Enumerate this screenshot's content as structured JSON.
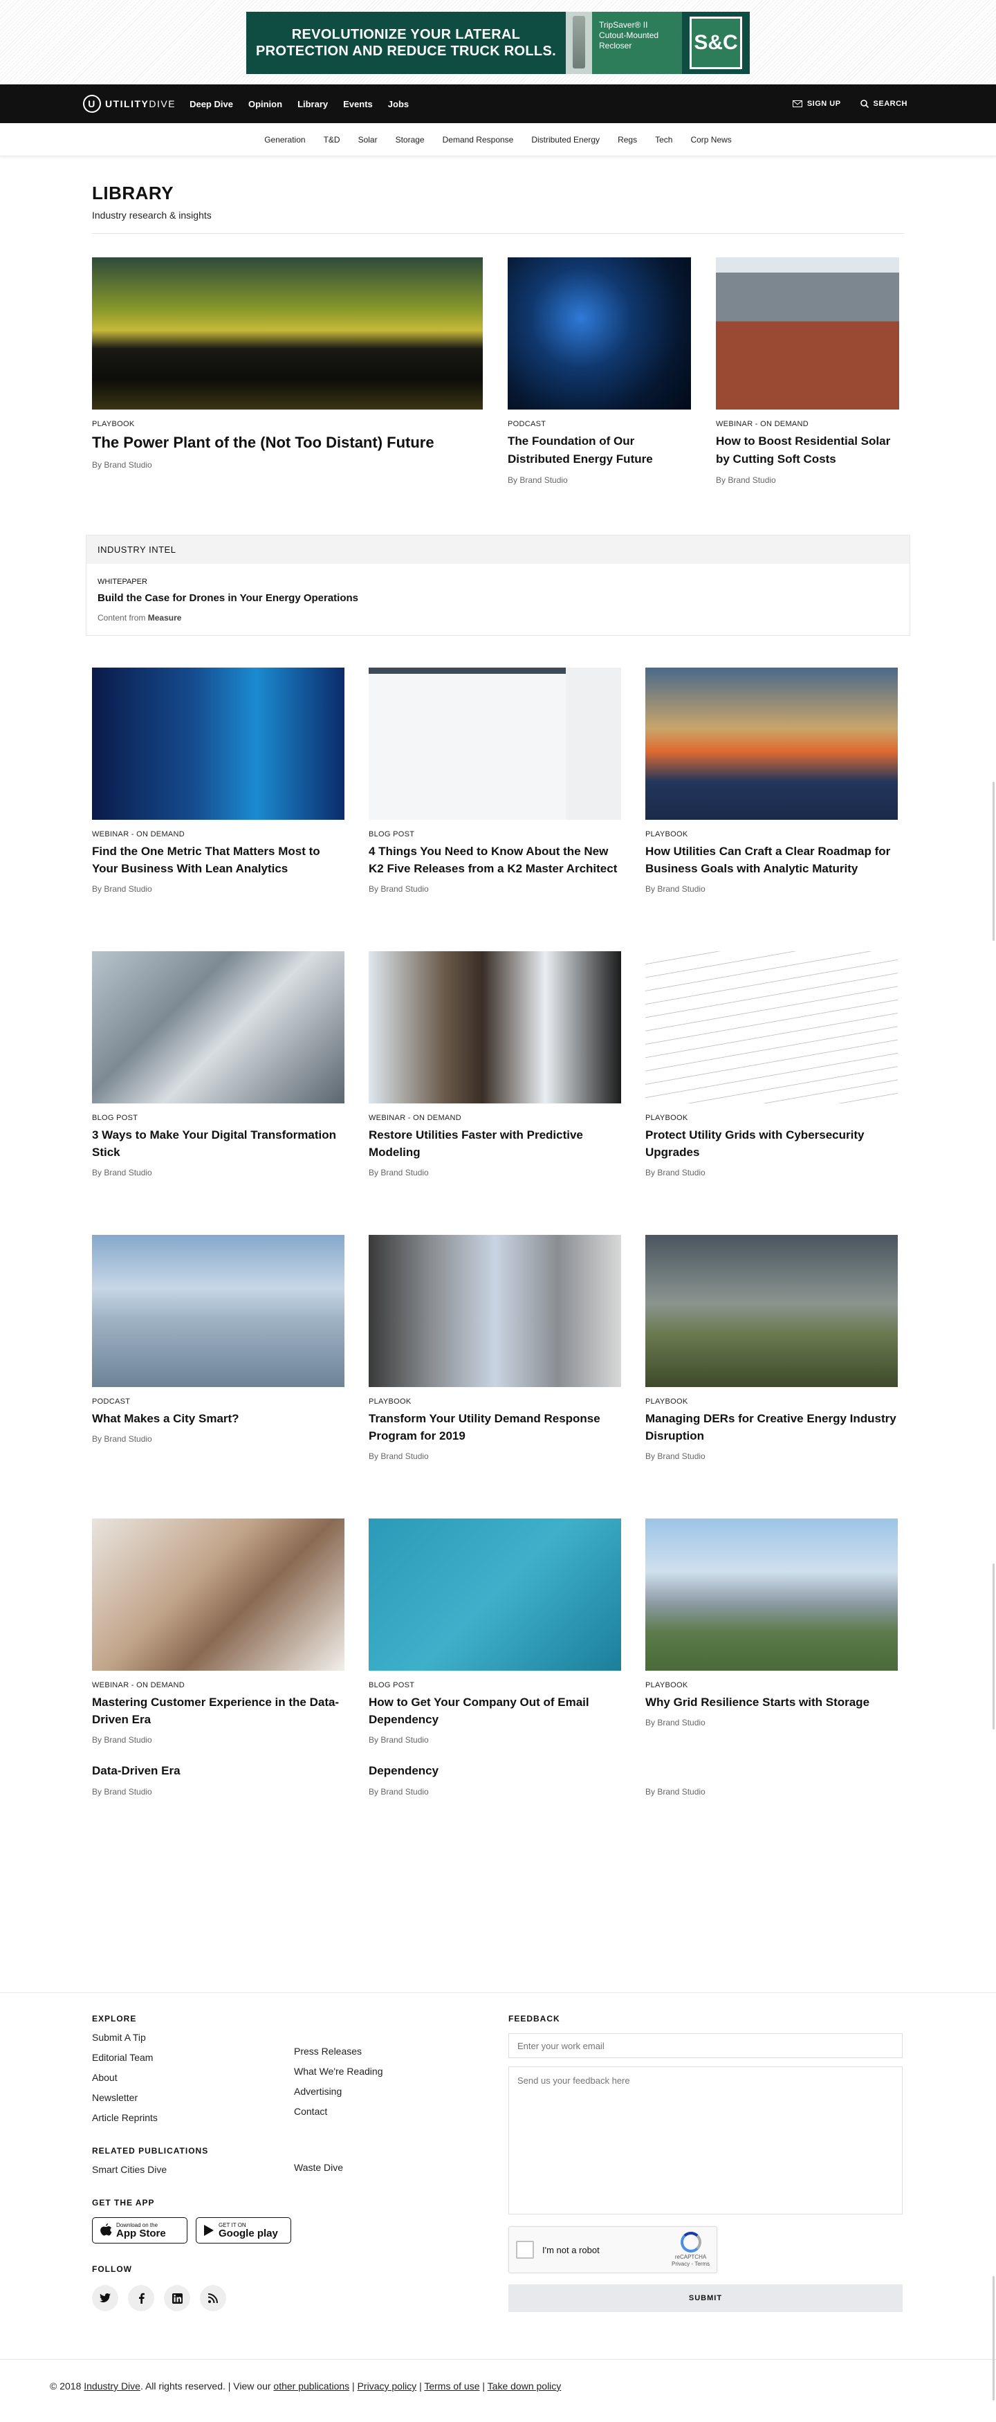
{
  "ad": {
    "headline_line1": "REVOLUTIONIZE YOUR LATERAL",
    "headline_line2": "PROTECTION AND REDUCE TRUCK ROLLS.",
    "product_line1": "TripSaver® II",
    "product_line2": "Cutout-Mounted",
    "product_line3": "Recloser",
    "logo_text": "S&C"
  },
  "nav": {
    "brand_bold": "UTILITY",
    "brand_rest": "DIVE",
    "links": [
      "Deep Dive",
      "Opinion",
      "Library",
      "Events",
      "Jobs"
    ],
    "signup": "SIGN UP",
    "search": "SEARCH"
  },
  "subnav": [
    "Generation",
    "T&D",
    "Solar",
    "Storage",
    "Demand Response",
    "Distributed Energy",
    "Regs",
    "Tech",
    "Corp News"
  ],
  "page": {
    "title": "LIBRARY",
    "subtitle": "Industry research & insights"
  },
  "featured": [
    {
      "category": "PLAYBOOK",
      "title": "The Power Plant of the (Not Too Distant) Future",
      "byline": "By Brand Studio"
    },
    {
      "category": "PODCAST",
      "title": "The Foundation of Our Distributed Energy Future",
      "byline": "By Brand Studio"
    },
    {
      "category": "WEBINAR - ON DEMAND",
      "title": "How to Boost Residential Solar by Cutting Soft Costs",
      "byline": "By Brand Studio"
    }
  ],
  "intel": {
    "heading": "INDUSTRY INTEL",
    "type": "WHITEPAPER",
    "title": "Build the Case for Drones in Your Energy Operations",
    "content_prefix": "Content from",
    "sponsor": "Measure"
  },
  "grid": [
    {
      "category": "WEBINAR - ON DEMAND",
      "title": "Find the One Metric That Matters Most to Your Business With Lean Analytics",
      "byline": "By Brand Studio"
    },
    {
      "category": "BLOG POST",
      "title": "4 Things You Need to Know About the New K2 Five Releases from a K2 Master Architect",
      "byline": "By Brand Studio"
    },
    {
      "category": "PLAYBOOK",
      "title": "How Utilities Can Craft a Clear Roadmap for Business Goals with Analytic Maturity",
      "byline": "By Brand Studio"
    },
    {
      "category": "BLOG POST",
      "title": "3 Ways to Make Your Digital Transformation Stick",
      "byline": "By Brand Studio"
    },
    {
      "category": "WEBINAR - ON DEMAND",
      "title": "Restore Utilities Faster with Predictive Modeling",
      "byline": "By Brand Studio"
    },
    {
      "category": "PLAYBOOK",
      "title": "Protect Utility Grids with Cybersecurity Upgrades",
      "byline": "By Brand Studio"
    },
    {
      "category": "PODCAST",
      "title": "What Makes a City Smart?",
      "byline": "By Brand Studio"
    },
    {
      "category": "PLAYBOOK",
      "title": "Transform Your Utility Demand Response Program for 2019",
      "byline": "By Brand Studio"
    },
    {
      "category": "PLAYBOOK",
      "title": "Managing DERs for Creative Energy Industry Disruption",
      "byline": "By Brand Studio"
    },
    {
      "category": "WEBINAR - ON DEMAND",
      "title": "Mastering Customer Experience in the Data-Driven Era",
      "byline": "By Brand Studio"
    },
    {
      "category": "BLOG POST",
      "title": "How to Get Your Company Out of Email Dependency",
      "byline": "By Brand Studio"
    },
    {
      "category": "PLAYBOOK",
      "title": "Why Grid Resilience Starts with Storage",
      "byline": "By Brand Studio"
    }
  ],
  "extras": [
    {
      "title": "Data-Driven Era",
      "byline": "By Brand Studio"
    },
    {
      "title": "Dependency",
      "byline": "By Brand Studio"
    },
    {
      "title": "",
      "byline": "By Brand Studio"
    }
  ],
  "footer": {
    "explore_heading": "EXPLORE",
    "explore_col1": [
      "Submit A Tip",
      "Editorial Team",
      "About",
      "Newsletter",
      "Article Reprints"
    ],
    "explore_col2": [
      "Press Releases",
      "What We're Reading",
      "Advertising",
      "Contact"
    ],
    "related_heading": "RELATED PUBLICATIONS",
    "related": [
      "Smart Cities Dive",
      "Waste Dive"
    ],
    "app_heading": "GET THE APP",
    "appstore_small": "Download on the",
    "appstore_big": "App Store",
    "gplay_small": "GET IT ON",
    "gplay_big": "Google play",
    "follow_heading": "FOLLOW",
    "feedback_heading": "FEEDBACK",
    "email_placeholder": "Enter your work email",
    "feedback_placeholder": "Send us your feedback here",
    "captcha_label": "I'm not a robot",
    "captcha_brand": "reCAPTCHA",
    "captcha_terms": "Privacy - Terms",
    "submit": "SUBMIT"
  },
  "copyright": {
    "prefix": "© 2018",
    "company": "Industry Dive",
    "mid": ". All rights reserved. | View our",
    "other_pubs": "other publications",
    "privacy": "Privacy policy",
    "terms": "Terms of use",
    "takedown": "Take down policy"
  },
  "colors": {
    "accent": "#0f4d43",
    "nav_bg": "#111111"
  }
}
